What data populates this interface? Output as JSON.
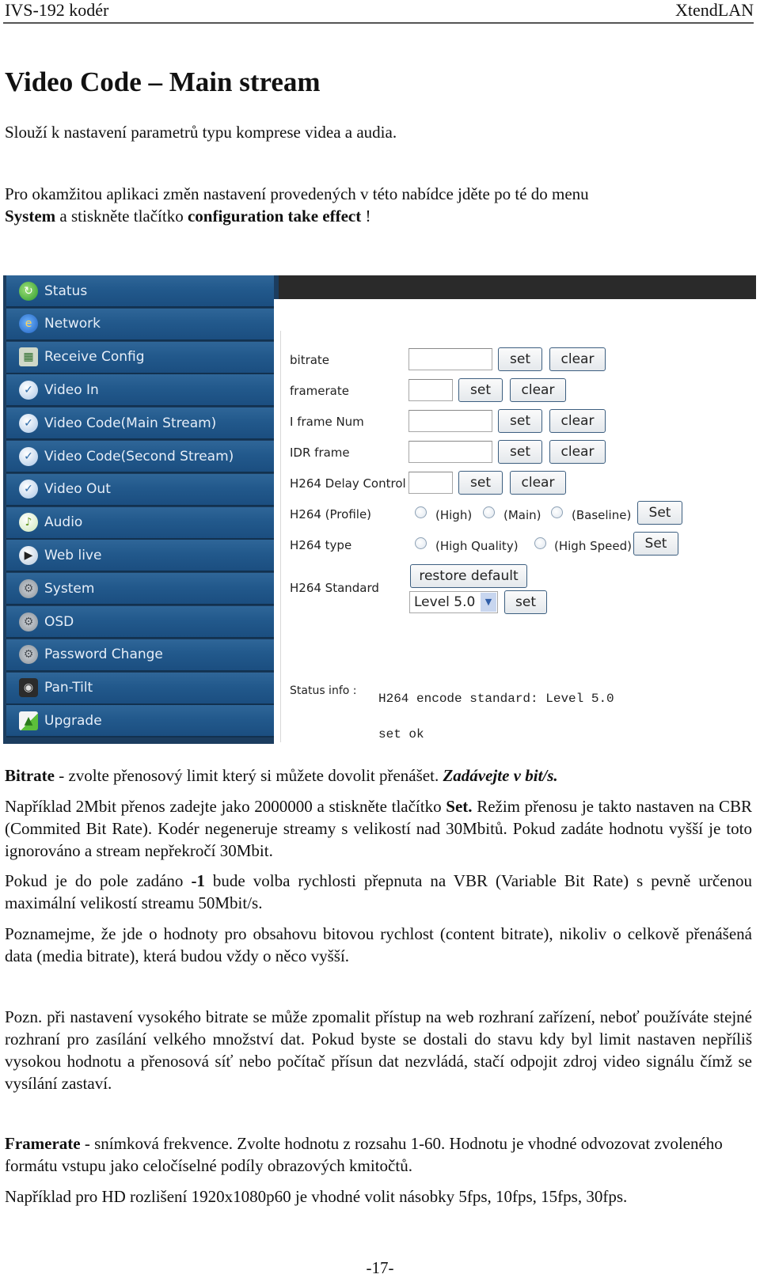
{
  "header": {
    "left": "IVS-192 kodér",
    "right": "XtendLAN"
  },
  "title": "Video Code – Main stream",
  "intro": "Slouží k nastavení parametrů typu komprese videa a audia.",
  "apply_note": {
    "line1": "Pro okamžitou aplikaci změn nastavení provedených v této nabídce jděte po té do menu",
    "bold1": "System",
    "mid": " a stiskněte tlačítko ",
    "bold2": "configuration take effect",
    "end": " !"
  },
  "ui": {
    "sidebar": {
      "items": [
        {
          "label": "Status",
          "icon": "status-refresh-icon",
          "glyph": "↻"
        },
        {
          "label": "Network",
          "icon": "network-globe-icon",
          "glyph": "e"
        },
        {
          "label": "Receive Config",
          "icon": "receive-config-icon",
          "glyph": "▦"
        },
        {
          "label": "Video In",
          "icon": "video-icon",
          "glyph": "✓"
        },
        {
          "label": "Video Code(Main Stream)",
          "icon": "video-icon",
          "glyph": "✓"
        },
        {
          "label": "Video Code(Second Stream)",
          "icon": "video-icon",
          "glyph": "✓"
        },
        {
          "label": "Video Out",
          "icon": "video-icon",
          "glyph": "✓"
        },
        {
          "label": "Audio",
          "icon": "audio-disc-icon",
          "glyph": "♪"
        },
        {
          "label": "Web live",
          "icon": "play-icon",
          "glyph": "▶"
        },
        {
          "label": "System",
          "icon": "gear-icon",
          "glyph": "⚙"
        },
        {
          "label": "OSD",
          "icon": "gear-icon",
          "glyph": "⚙"
        },
        {
          "label": "Password Change",
          "icon": "gear-icon",
          "glyph": "⚙"
        },
        {
          "label": "Pan-Tilt",
          "icon": "camera-icon",
          "glyph": "◉"
        },
        {
          "label": "Upgrade",
          "icon": "upgrade-icon",
          "glyph": "▲"
        }
      ]
    },
    "form": {
      "bitrate": {
        "label": "bitrate",
        "value": "",
        "set": "set",
        "clear": "clear"
      },
      "framerate": {
        "label": "framerate",
        "value": "",
        "set": "set",
        "clear": "clear"
      },
      "iframe": {
        "label": "I frame Num",
        "value": "",
        "set": "set",
        "clear": "clear"
      },
      "idr": {
        "label": "IDR frame",
        "value": "",
        "set": "set",
        "clear": "clear"
      },
      "delay": {
        "label": "H264 Delay Control",
        "value": "",
        "set": "set",
        "clear": "clear"
      },
      "profile": {
        "label": "H264 (Profile)",
        "options": [
          "(High)",
          "(Main)",
          "(Baseline)"
        ],
        "set": "Set"
      },
      "type": {
        "label": "H264 type",
        "options": [
          "(High Quality)",
          "(High Speed)"
        ],
        "set": "Set"
      },
      "standard": {
        "label": "H264 Standard",
        "restore": "restore default",
        "selected": "Level 5.0",
        "set": "set"
      }
    },
    "status": {
      "label": "Status info :",
      "line1": "H264 encode standard: Level 5.0",
      "line2": "set ok"
    }
  },
  "bitrate_section": {
    "head_bold": "Bitrate",
    "head_text": " - zvolte přenosový limit který si můžete dovolit přenášet. ",
    "head_italic": "Zadávejte v bit/s.",
    "p1_a": "Například 2Mbit přenos zadejte jako 2000000 a stiskněte tlačítko ",
    "p1_bold": "Set.",
    "p1_b": " Režim přenosu je takto nastaven na CBR (Commited Bit Rate). Kodér negeneruje streamy s velikostí nad 30Mbitů. Pokud zadáte hodnotu vyšší je toto ignorováno a stream nepřekročí 30Mbit.",
    "p2_a": "Pokud je do pole zadáno ",
    "p2_bold": "-1",
    "p2_b": " bude volba rychlosti přepnuta na VBR (Variable Bit Rate) s pevně určenou maximální velikostí streamu 50Mbit/s.",
    "p3": "Poznamejme, že jde o hodnoty pro obsahovu bitovou rychlost (content bitrate), nikoliv o celkově přenášená data (media bitrate), která budou vždy o něco vyšší.",
    "p4": "Pozn. při nastavení vysokého bitrate se může zpomalit přístup na web rozhraní zařízení, neboť používáte stejné rozhraní pro zasílání velkého množství dat. Pokud byste se dostali do stavu kdy byl limit nastaven nepříliš vysokou hodnotu a přenosová síť nebo počítač přísun dat nezvládá, stačí odpojit zdroj video signálu čímž se vysílání zastaví."
  },
  "framerate_section": {
    "head_bold": "Framerate",
    "head_text": " - snímková frekvence. Zvolte hodnotu z rozsahu 1-60. Hodnotu je vhodné odvozovat zvoleného formátu vstupu jako celočíselné podíly obrazových kmitočtů.",
    "p1": "Například pro HD rozlišení 1920x1080p60 je vhodné volit násobky  5fps, 10fps, 15fps, 30fps."
  },
  "page_number": "-17-"
}
